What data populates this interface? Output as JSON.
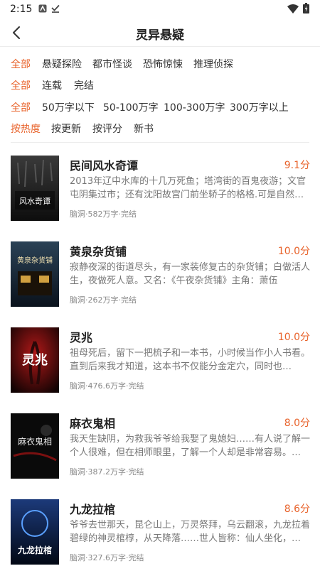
{
  "status": {
    "time": "2:15"
  },
  "header": {
    "title": "灵异悬疑"
  },
  "filters": {
    "category": [
      "全部",
      "悬疑探险",
      "都市怪谈",
      "恐怖惊悚",
      "推理侦探"
    ],
    "status": [
      "全部",
      "连载",
      "完结"
    ],
    "length": [
      "全部",
      "50万字以下",
      "50-100万字",
      "100-300万字",
      "300万字以上"
    ],
    "sort": [
      "按热度",
      "按更新",
      "按评分",
      "新书"
    ]
  },
  "books": [
    {
      "title": "民间风水奇谭",
      "score": "9.1分",
      "desc": "2013年辽中水库的十几万死鱼；塔湾街的百鬼夜游；文官屯阴集过市；还有沈阳故宫门前坐轿子的格格.可是自然…",
      "meta": "脑洞·582万字·完结",
      "cover_text": "风水奇谭",
      "cover_colors": [
        "#1a1a1a",
        "#3a3a3a"
      ]
    },
    {
      "title": "黄泉杂货铺",
      "score": "10.0分",
      "desc": "寂静夜深的街道尽头，有一家装修复古的杂货铺；白做活人生，夜做死人意。又名：《午夜杂货铺》主角：萧伍",
      "meta": "脑洞·262万字·完结",
      "cover_text": "黄泉杂货铺",
      "cover_colors": [
        "#1b2a3a",
        "#0d1621"
      ]
    },
    {
      "title": "灵兆",
      "score": "10.0分",
      "desc": "祖母死后，留下一把梳子和一本书，小时候当作小人书看。直到后来我才知道，这本书不仅能分金定穴，同时也…",
      "meta": "脑洞·476.6万字·完结",
      "cover_text": "灵兆",
      "cover_colors": [
        "#6a0d0d",
        "#1a0505"
      ]
    },
    {
      "title": "麻衣鬼相",
      "score": "8.0分",
      "desc": "我天生缺阴，为救我爷爷给我娶了鬼媳妇……有人说了解一个人很难，但在相师眼里，了解一个人却是非常容易。…",
      "meta": "脑洞·387.2万字·完结",
      "cover_text": "麻衣鬼相",
      "cover_colors": [
        "#1c1c1c",
        "#050505"
      ]
    },
    {
      "title": "九龙拉棺",
      "score": "8.6分",
      "desc": "爷爷去世那天，昆仑山上，万灵祭拜，乌云翻滚，九龙拉着碧绿的神灵棺椁，从天降落……世人皆称：仙人坐化，…",
      "meta": "脑洞·327.6万字·完结",
      "cover_text": "九龙拉棺",
      "cover_colors": [
        "#0a1a3a",
        "#020814"
      ]
    }
  ]
}
